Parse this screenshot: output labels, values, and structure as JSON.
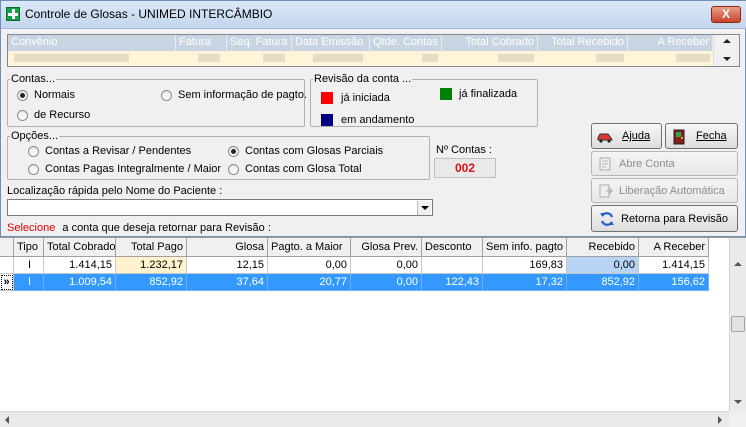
{
  "window": {
    "title": "Controle de Glosas - UNIMED INTERCÂMBIO",
    "close_label": "X"
  },
  "convenio_grid": {
    "columns": [
      "Convênio",
      "Fatura",
      "Seq. Fatura",
      "Data Emissão",
      "Qtde. Contas",
      "Total Cobrado",
      "Total Recebido",
      "A Receber"
    ]
  },
  "contas": {
    "legend": "Contas...",
    "options": [
      "Normais",
      "de Recurso",
      "Sem informação de pagto."
    ],
    "selected": "Normais"
  },
  "revisao": {
    "legend": "Revisão da conta ...",
    "items": [
      {
        "label": "já iniciada",
        "color": "#ff0000"
      },
      {
        "label": "já finalizada",
        "color": "#008000"
      },
      {
        "label": "em andamento",
        "color": "#000080"
      }
    ]
  },
  "opcoes": {
    "legend": "Opções...",
    "options": [
      "Contas a Revisar / Pendentes",
      "Contas Pagas Integralmente / Maior",
      "Contas com Glosas Parciais",
      "Contas com Glosa Total"
    ],
    "selected": "Contas com Glosas Parciais"
  },
  "num_contas": {
    "label": "Nº Contas :",
    "value": "002"
  },
  "buttons": {
    "ajuda": "Ajuda",
    "fecha": "Fecha",
    "abre_conta": "Abre Conta",
    "liberacao": "Liberação Automática",
    "retorna": "Retorna para Revisão"
  },
  "search": {
    "label": "Localização rápida pelo Nome do Paciente :",
    "value": ""
  },
  "instruction": {
    "highlight": "Selecione",
    "rest": "a conta que deseja retornar para Revisão :"
  },
  "main_grid": {
    "columns": [
      "Tipo",
      "Total Cobrado",
      "Total Pago",
      "Glosa",
      "Pagto. a Maior",
      "Glosa Prev.",
      "Desconto",
      "Sem info. pagto",
      "Recebido",
      "A Receber"
    ],
    "rows": [
      [
        "I",
        "1.414,15",
        "1.232,17",
        "12,15",
        "0,00",
        "0,00",
        "",
        "169,83",
        "0,00",
        "1.414,15"
      ],
      [
        "I",
        "1.009,54",
        "852,92",
        "37,64",
        "20,77",
        "0,00",
        "122,43",
        "17,32",
        "852,92",
        "156,62"
      ]
    ],
    "selected_row": 1,
    "row_indicator": "»"
  }
}
